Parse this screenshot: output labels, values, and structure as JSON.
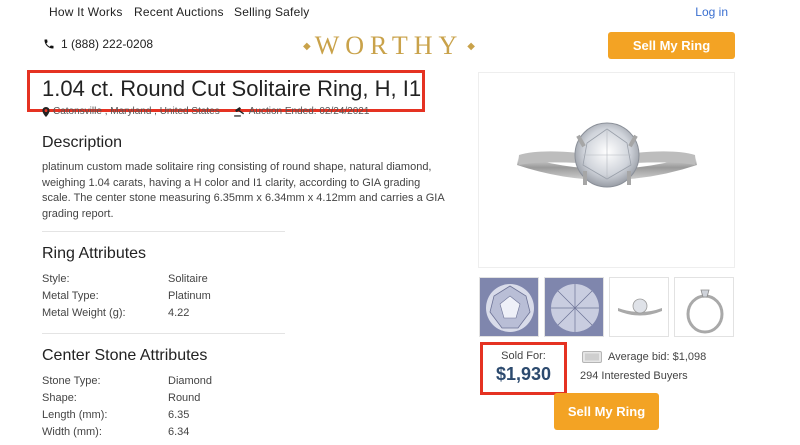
{
  "nav": {
    "items": [
      "How It Works",
      "Recent Auctions",
      "Selling Safely"
    ],
    "login": "Log in"
  },
  "header": {
    "phone": "1 (888) 222-0208",
    "logo": "WORTHY",
    "sell_button": "Sell My Ring"
  },
  "listing": {
    "title": "1.04 ct. Round Cut Solitaire Ring, H, I1",
    "location": "Catonsville , Maryland , United States",
    "auction_ended": "Auction Ended: 02/24/2021"
  },
  "description": {
    "heading": "Description",
    "text": "platinum custom made solitaire ring consisting of round shape, natural diamond, weighing 1.04 carats, having a H color and I1 clarity, according to GIA grading scale. The center stone measuring 6.35mm x 6.34mm x 4.12mm and carries a GIA grading report."
  },
  "ring_attributes": {
    "heading": "Ring Attributes",
    "rows": [
      {
        "label": "Style:",
        "value": "Solitaire"
      },
      {
        "label": "Metal Type:",
        "value": "Platinum"
      },
      {
        "label": "Metal Weight (g):",
        "value": "4.22"
      }
    ]
  },
  "center_stone": {
    "heading": "Center Stone Attributes",
    "rows": [
      {
        "label": "Stone Type:",
        "value": "Diamond"
      },
      {
        "label": "Shape:",
        "value": "Round"
      },
      {
        "label": "Length (mm):",
        "value": "6.35"
      },
      {
        "label": "Width (mm):",
        "value": "6.34"
      }
    ]
  },
  "sale": {
    "sold_label": "Sold For:",
    "sold_price": "$1,930",
    "average_bid": "Average bid: $1,098",
    "interested": "294 Interested Buyers",
    "sell_button": "Sell My Ring"
  },
  "colors": {
    "accent": "#f3a324",
    "highlight": "#e53222",
    "logo": "#c9a24a",
    "price": "#2c4a6e",
    "link": "#3a6fd0"
  }
}
